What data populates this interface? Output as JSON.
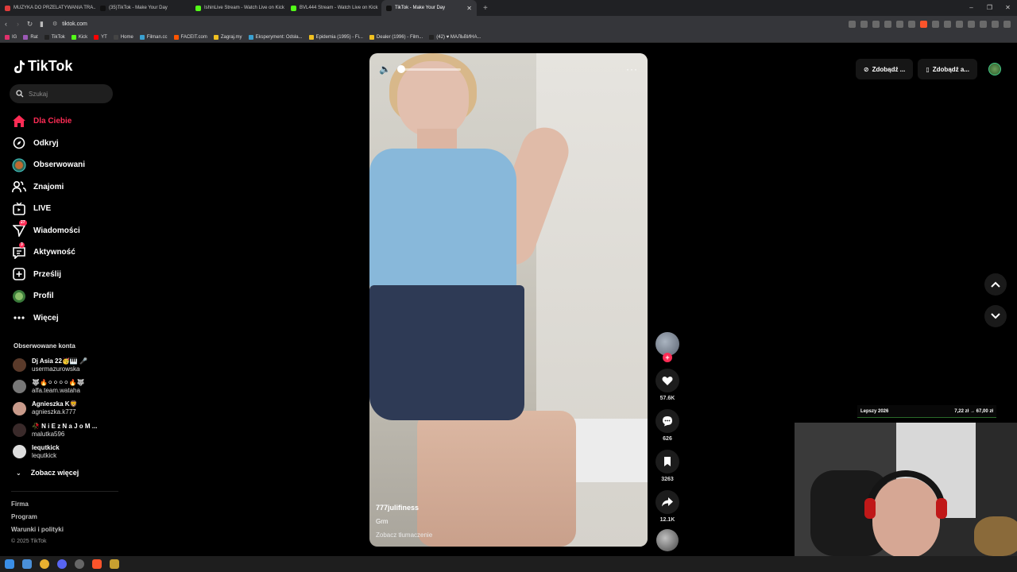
{
  "browser": {
    "tabs": [
      {
        "label": "MUZYKA DO PRZELATYWANIA TRA...",
        "color": "#e03c3c",
        "active": false
      },
      {
        "label": "(35)TikTok - Make Your Day",
        "color": "#111111",
        "active": false
      },
      {
        "label": "IshinLive Stream - Watch Live on Kick",
        "color": "#53fc18",
        "active": false
      },
      {
        "label": "BVL444 Stream - Watch Live on Kick",
        "color": "#53fc18",
        "active": false
      },
      {
        "label": "TikTok - Make Your Day",
        "color": "#111111",
        "active": true
      }
    ],
    "url": "tiktok.com",
    "bookmarks": [
      {
        "label": "IG",
        "color": "#e1306c"
      },
      {
        "label": "Rat",
        "color": "#9b59b6"
      },
      {
        "label": "TikTok",
        "color": "#222222"
      },
      {
        "label": "Kick",
        "color": "#53fc18"
      },
      {
        "label": "YT",
        "color": "#ff0000"
      },
      {
        "label": "Home",
        "color": "#444444"
      },
      {
        "label": "Filman.cc",
        "color": "#3aa0d0"
      },
      {
        "label": "FACEIT.com",
        "color": "#ff5500"
      },
      {
        "label": "Zagraj.my",
        "color": "#f0c020"
      },
      {
        "label": "Eksperyment: Odsła...",
        "color": "#3aa0d0"
      },
      {
        "label": "Epidemia (1995) - Fi...",
        "color": "#f0c020"
      },
      {
        "label": "Dealer (1996) - Film...",
        "color": "#f0c020"
      },
      {
        "label": "(42) ♥ МАЛЬВИНА...",
        "color": "#222222"
      }
    ]
  },
  "sidebar": {
    "logo": "TikTok",
    "search_placeholder": "Szukaj",
    "nav": [
      {
        "label": "Dla Ciebie",
        "icon": "home-icon",
        "active": true
      },
      {
        "label": "Odkryj",
        "icon": "compass-icon"
      },
      {
        "label": "Obserwowani",
        "icon": "following-avatar-icon"
      },
      {
        "label": "Znajomi",
        "icon": "friends-icon"
      },
      {
        "label": "LIVE",
        "icon": "live-icon"
      },
      {
        "label": "Wiadomości",
        "icon": "messages-icon",
        "badge": "27"
      },
      {
        "label": "Aktywność",
        "icon": "activity-icon",
        "badge": "3"
      },
      {
        "label": "Prześlij",
        "icon": "upload-icon"
      },
      {
        "label": "Profil",
        "icon": "profile-avatar-icon"
      },
      {
        "label": "Więcej",
        "icon": "more-icon"
      }
    ],
    "following_title": "Obserwowane konta",
    "following": [
      {
        "name": "Dj Asia 22🥳🎹 🎤",
        "handle": "usermazurowska",
        "color": "#5a3a2a"
      },
      {
        "name": "🐺🔥⚪⚪⚪⚪🔥🐺",
        "handle": "alfa.team.wataha",
        "color": "#777777"
      },
      {
        "name": "Agnieszka K🦁",
        "handle": "agnieszka.k777",
        "color": "#c89a8a"
      },
      {
        "name": "🥀 N i E z N a J o M ...",
        "handle": "malutka596",
        "color": "#3a2a2a"
      },
      {
        "name": "lequtkick",
        "handle": "lequtkick",
        "color": "#dddddd"
      }
    ],
    "see_more": "Zobacz więcej",
    "footer": [
      "Firma",
      "Program",
      "Warunki i polityki"
    ],
    "copyright": "© 2025 TikTok"
  },
  "video": {
    "username": "777julifiness",
    "description": "Grm",
    "translate": "Zobacz tłumaczenie",
    "likes": "57.6K",
    "comments": "626",
    "saves": "3263",
    "shares": "12.1K"
  },
  "topright": {
    "coins_label": "Zdobądź ...",
    "app_label": "Zdobądź a..."
  },
  "overlay": {
    "ticker_label": "Lepszy 2026",
    "ticker_value": "7,22 zł → 67,00 zł"
  },
  "colors": {
    "accent": "#fe2c55",
    "background": "#000000"
  }
}
